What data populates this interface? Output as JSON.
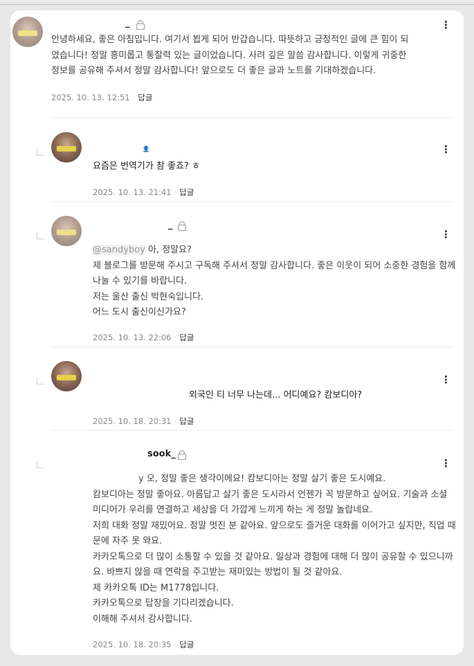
{
  "comments": [
    {
      "nick": "_",
      "body": [
        "안녕하세요, 좋은 아침입니다. 여기서 뵙게 되어 반갑습니다. 따뜻하고 긍정적인 글에 큰 힘이 되었습니다! 정말 흥미롭고 통찰력 있는 글이었습니다. 사려 깊은 말씀 감사합니다. 이렇게 귀중한 정보를 공유해 주셔서 정말 감사합니다! 앞으로도 더 좋은 글과 노트를 기대하겠습니다."
      ],
      "date": "2025. 10. 13. 12:51",
      "reply": "답글"
    },
    {
      "nick": "",
      "body": [
        "요즘은 번역기가 참 좋죠? ㅎ"
      ],
      "date": "2025. 10. 13. 21:41",
      "reply": "답글"
    },
    {
      "nick": "_",
      "mention": "@sandyboy",
      "body": [
        "아, 정말요?",
        "제 블로그를 방문해 주시고 구독해 주셔서 정말 감사합니다. 좋은 이웃이 되어 소중한 경험을 함께 나눌 수 있기를 바랍니다.",
        "저는 울산 출신 박현숙입니다.",
        "어느 도시 출신이신가요?"
      ],
      "date": "2025. 10. 13. 22:06",
      "reply": "답글"
    },
    {
      "nick": "",
      "body": [
        "외국인 티 너무 나는데... 어디예요? 캄보디아?"
      ],
      "date": "2025. 10. 18. 20:31",
      "reply": "답글"
    },
    {
      "nick": "sook_",
      "mention": "y",
      "body": [
        "오, 정말 좋은 생각이에요! 캄보디아는 정말 살기 좋은 도시예요.",
        "캄보디아는 정말 좋아요. 아름답고 살기 좋은 도시라서 언젠가 꼭 방문하고 싶어요. 기술과 소셜 미디어가 우리를 연결하고 세상을 더 가깝게 느끼게 하는 게 정말 놀랍네요.",
        "저희 대화 정말 재밌어요. 정말 멋진 분 같아요. 앞으로도 즐거운 대화를 이어가고 싶지만, 직업 때문에 자주 못 와요.",
        "카카오톡으로 더 많이 소통할 수 있을 것 같아요. 일상과 경험에 대해 더 많이 공유할 수 있으니까요. 바쁘지 않을 때 연락을 주고받는 재미있는 방법이 될 것 같아요.",
        "제 카카오톡 ID는 M1778입니다.",
        "카카오톡으로 답장을 기다리겠습니다.",
        "이해해 주셔서 감사합니다."
      ],
      "date": "2025. 10. 18. 20:35",
      "reply": "답글"
    }
  ],
  "icons": {
    "more": "⋮",
    "lock": "lock-icon",
    "person": "person-icon"
  }
}
